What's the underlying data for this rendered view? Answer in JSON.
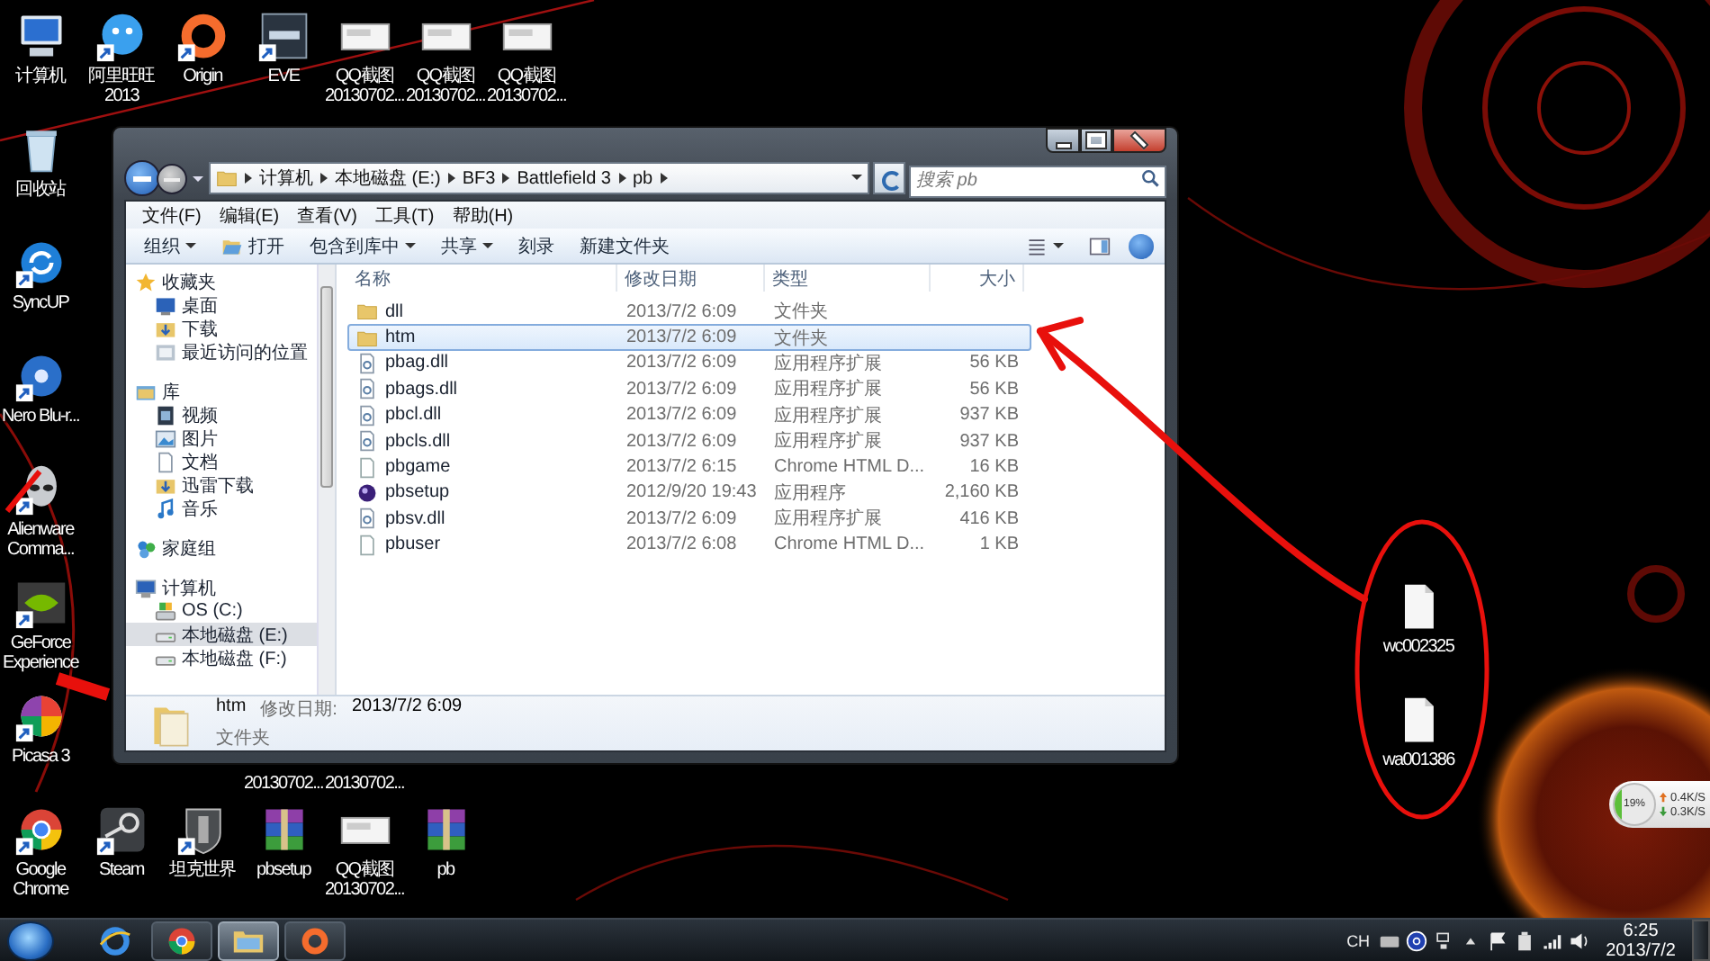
{
  "desktop": {
    "top_row": [
      {
        "label": "计算机",
        "kind": "computer",
        "shortcut": false
      },
      {
        "label": "阿里旺旺 2013",
        "kind": "messenger",
        "shortcut": true
      },
      {
        "label": "Origin",
        "kind": "origin",
        "shortcut": true
      },
      {
        "label": "EVE",
        "kind": "eve",
        "shortcut": true
      },
      {
        "label": "QQ截图 20130702...",
        "kind": "image",
        "shortcut": false
      },
      {
        "label": "QQ截图 20130702...",
        "kind": "image",
        "shortcut": false
      },
      {
        "label": "QQ截图 20130702...",
        "kind": "image",
        "shortcut": false
      }
    ],
    "left_column": [
      {
        "label": "回收站",
        "kind": "recycle",
        "shortcut": false
      },
      {
        "label": "SyncUP",
        "kind": "sync",
        "shortcut": true
      },
      {
        "label": "Nero Blu-r...",
        "kind": "disc",
        "shortcut": true
      },
      {
        "label": "Alienware Comma...",
        "kind": "alien",
        "shortcut": true
      },
      {
        "label": "GeForce Experience",
        "kind": "nvidia",
        "shortcut": true
      },
      {
        "label": "Picasa 3",
        "kind": "picasa",
        "shortcut": true
      }
    ],
    "covered_labels": [
      "20130702...",
      "20130702..."
    ],
    "bottom_row": [
      {
        "label": "Google Chrome",
        "kind": "chrome",
        "shortcut": true
      },
      {
        "label": "Steam",
        "kind": "steam",
        "shortcut": true
      },
      {
        "label": "坦克世界",
        "kind": "tank",
        "shortcut": true
      },
      {
        "label": "pbsetup",
        "kind": "archive",
        "shortcut": false
      },
      {
        "label": "QQ截图 20130702...",
        "kind": "image",
        "shortcut": false
      },
      {
        "label": "pb",
        "kind": "archive",
        "shortcut": false
      }
    ],
    "files": [
      {
        "label": "wc002325"
      },
      {
        "label": "wa001386"
      }
    ]
  },
  "explorer": {
    "breadcrumb": [
      "计算机",
      "本地磁盘 (E:)",
      "BF3",
      "Battlefield 3",
      "pb"
    ],
    "search": {
      "placeholder": "搜索 pb"
    },
    "menu": [
      "文件(F)",
      "编辑(E)",
      "查看(V)",
      "工具(T)",
      "帮助(H)"
    ],
    "toolbar": [
      {
        "label": "组织",
        "kind": "menu"
      },
      {
        "label": "打开",
        "kind": "open"
      },
      {
        "label": "包含到库中",
        "kind": "menu"
      },
      {
        "label": "共享",
        "kind": "menu"
      },
      {
        "label": "刻录",
        "kind": "plain"
      },
      {
        "label": "新建文件夹",
        "kind": "plain"
      }
    ],
    "nav": [
      {
        "label": "收藏夹",
        "kind": "star",
        "selected": false,
        "children": [
          {
            "label": "桌面",
            "kind": "desktop",
            "selected": false
          },
          {
            "label": "下载",
            "kind": "download",
            "selected": false
          },
          {
            "label": "最近访问的位置",
            "kind": "recent",
            "selected": false
          }
        ]
      },
      {
        "label": "库",
        "kind": "library",
        "selected": false,
        "children": [
          {
            "label": "视频",
            "kind": "video",
            "selected": false
          },
          {
            "label": "图片",
            "kind": "pictures",
            "selected": false
          },
          {
            "label": "文档",
            "kind": "documents",
            "selected": false
          },
          {
            "label": "迅雷下载",
            "kind": "download",
            "selected": false
          },
          {
            "label": "音乐",
            "kind": "music",
            "selected": false
          }
        ]
      },
      {
        "label": "家庭组",
        "kind": "homegroup",
        "selected": false
      },
      {
        "label": "计算机",
        "kind": "computer",
        "selected": false,
        "children": [
          {
            "label": "OS (C:)",
            "kind": "drive-os",
            "selected": false
          },
          {
            "label": "本地磁盘 (E:)",
            "kind": "drive",
            "selected": true
          },
          {
            "label": "本地磁盘 (F:)",
            "kind": "drive",
            "selected": false
          }
        ]
      }
    ],
    "columns": [
      "名称",
      "修改日期",
      "类型",
      "大小"
    ],
    "rows": [
      {
        "name": "dll",
        "kind": "folder",
        "date": "2013/7/2 6:09",
        "type": "文件夹",
        "selected": false
      },
      {
        "name": "htm",
        "kind": "folder",
        "date": "2013/7/2 6:09",
        "type": "文件夹",
        "selected": true
      },
      {
        "name": "pbag.dll",
        "kind": "dll",
        "date": "2013/7/2 6:09",
        "type": "应用程序扩展",
        "size": "56 KB",
        "selected": false
      },
      {
        "name": "pbags.dll",
        "kind": "dll",
        "date": "2013/7/2 6:09",
        "type": "应用程序扩展",
        "size": "56 KB",
        "selected": false
      },
      {
        "name": "pbcl.dll",
        "kind": "dll",
        "date": "2013/7/2 6:09",
        "type": "应用程序扩展",
        "size": "937 KB",
        "selected": false
      },
      {
        "name": "pbcls.dll",
        "kind": "dll",
        "date": "2013/7/2 6:09",
        "type": "应用程序扩展",
        "size": "937 KB",
        "selected": false
      },
      {
        "name": "pbgame",
        "kind": "html",
        "date": "2013/7/2 6:15",
        "type": "Chrome HTML D...",
        "size": "16 KB",
        "selected": false
      },
      {
        "name": "pbsetup",
        "kind": "setup",
        "date": "2012/9/20 19:43",
        "type": "应用程序",
        "size": "2,160 KB",
        "selected": false
      },
      {
        "name": "pbsv.dll",
        "kind": "dll",
        "date": "2013/7/2 6:09",
        "type": "应用程序扩展",
        "size": "416 KB",
        "selected": false
      },
      {
        "name": "pbuser",
        "kind": "html",
        "date": "2013/7/2 6:08",
        "type": "Chrome HTML D...",
        "size": "1 KB",
        "selected": false
      }
    ],
    "details": {
      "name": "htm",
      "date_label": "修改日期:",
      "date": "2013/7/2 6:09",
      "type": "文件夹"
    }
  },
  "net_monitor": {
    "percent": "19%",
    "level": 0.19,
    "upload": "0.4K/S",
    "download": "0.3K/S"
  },
  "taskbar": {
    "apps": [
      {
        "kind": "ie",
        "open": false,
        "active": false
      },
      {
        "kind": "chrome",
        "open": true,
        "active": false
      },
      {
        "kind": "explorer",
        "open": true,
        "active": true
      },
      {
        "kind": "origin",
        "open": true,
        "active": false
      }
    ],
    "language": "CH",
    "time": "6:25",
    "date": "2013/7/2"
  }
}
